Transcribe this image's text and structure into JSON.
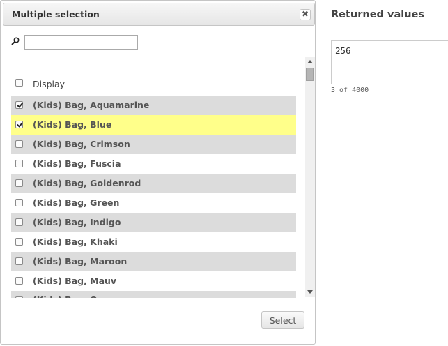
{
  "dialog": {
    "title": "Multiple selection",
    "close_glyph": "✖",
    "search": {
      "value": "",
      "placeholder": ""
    },
    "list_header": {
      "label": "Display",
      "checked": false
    },
    "items": [
      {
        "label": "(Kids) Bag, Aquamarine",
        "checked": true
      },
      {
        "label": "(Kids) Bag, Blue",
        "checked": true
      },
      {
        "label": "(Kids) Bag, Crimson",
        "checked": false
      },
      {
        "label": "(Kids) Bag, Fuscia",
        "checked": false
      },
      {
        "label": "(Kids) Bag, Goldenrod",
        "checked": false
      },
      {
        "label": "(Kids) Bag, Green",
        "checked": false
      },
      {
        "label": "(Kids) Bag, Indigo",
        "checked": false
      },
      {
        "label": "(Kids) Bag, Khaki",
        "checked": false
      },
      {
        "label": "(Kids) Bag, Maroon",
        "checked": false
      },
      {
        "label": "(Kids) Bag, Mauv",
        "checked": false
      },
      {
        "label": "(Kids) Bag, Orange",
        "checked": false
      }
    ],
    "select_label": "Select"
  },
  "panel": {
    "title": "Returned values",
    "value": "256",
    "count": "3 of 4000"
  },
  "colors": {
    "row_shaded": "#dcdcdc",
    "row_highlight": "#ffff8a"
  }
}
